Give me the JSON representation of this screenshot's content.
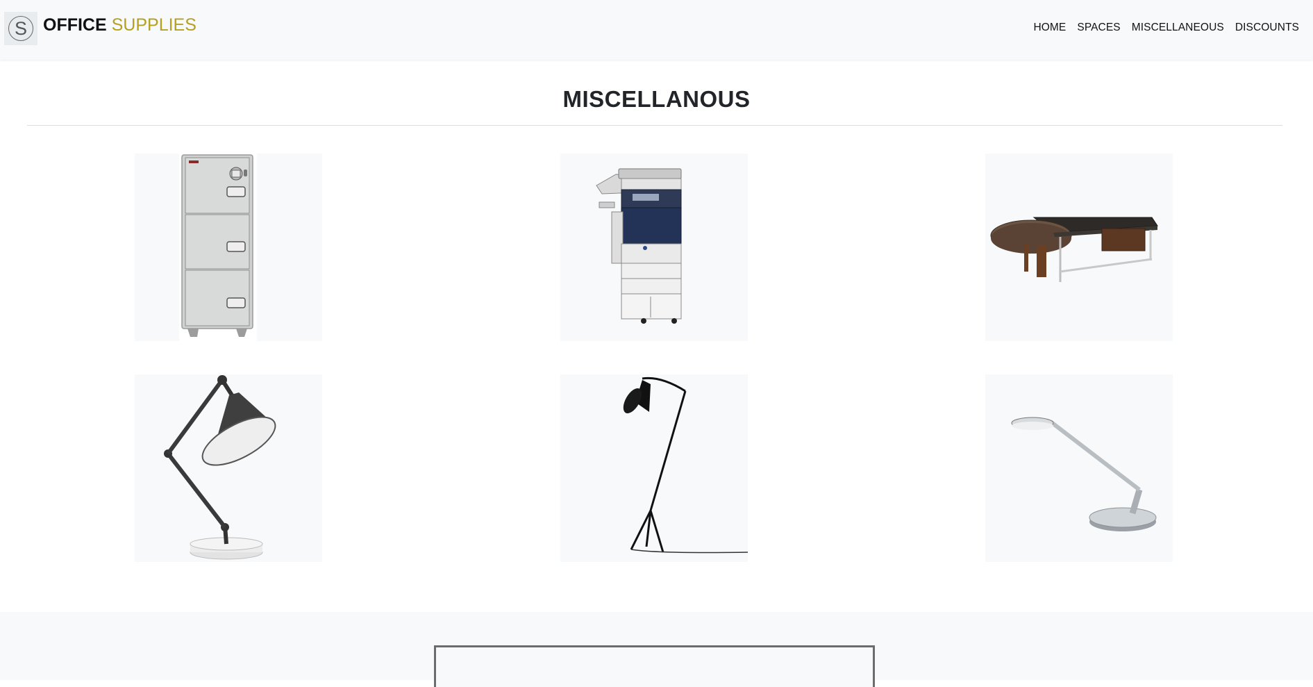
{
  "brand": {
    "logo_letter": "S",
    "name_bold": "OFFICE",
    "name_accent": "SUPPLIES",
    "accent_color": "#b5a020"
  },
  "nav": {
    "items": [
      {
        "label": "HOME"
      },
      {
        "label": "SPACES"
      },
      {
        "label": "MISCELLANEOUS"
      },
      {
        "label": "DISCOUNTS"
      }
    ]
  },
  "page": {
    "title": "MISCELLANOUS"
  },
  "products": [
    {
      "name": "filing-cabinet"
    },
    {
      "name": "photocopier"
    },
    {
      "name": "executive-desk"
    },
    {
      "name": "desk-lamp"
    },
    {
      "name": "floor-lamp"
    },
    {
      "name": "led-desk-lamp"
    }
  ]
}
